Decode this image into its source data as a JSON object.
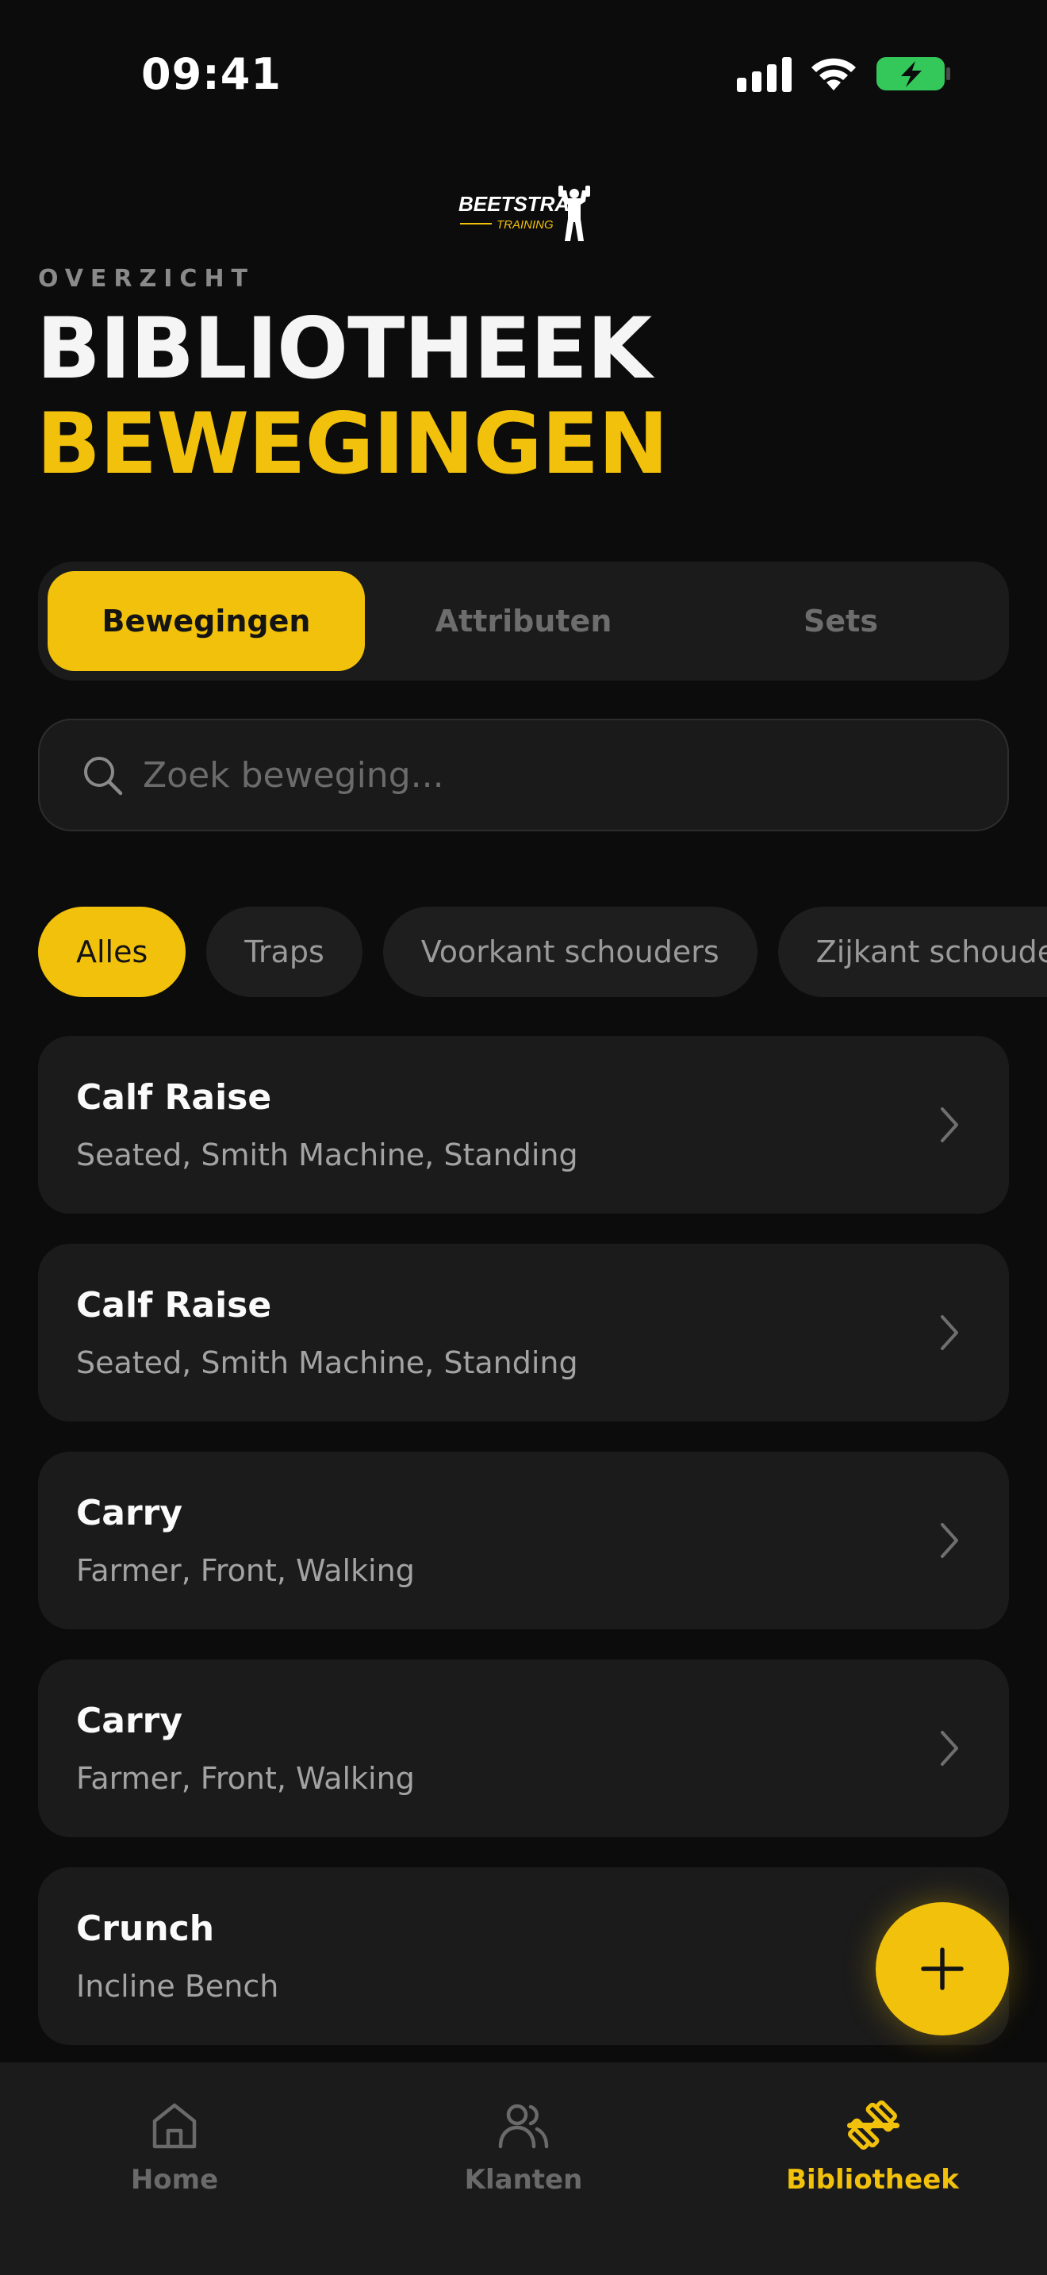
{
  "status_bar": {
    "time": "09:41"
  },
  "brand": {
    "name": "BEETSTRA",
    "tagline": "TRAINING"
  },
  "header": {
    "eyebrow": "OVERZICHT",
    "title_line1": "BIBLIOTHEEK",
    "title_line2": "BEWEGINGEN"
  },
  "tabs": [
    {
      "label": "Bewegingen",
      "active": true
    },
    {
      "label": "Attributen",
      "active": false
    },
    {
      "label": "Sets",
      "active": false
    }
  ],
  "search": {
    "placeholder": "Zoek beweging...",
    "value": ""
  },
  "filters": [
    {
      "label": "Alles",
      "active": true
    },
    {
      "label": "Traps",
      "active": false
    },
    {
      "label": "Voorkant schouders",
      "active": false
    },
    {
      "label": "Zijkant schouders",
      "active": false
    }
  ],
  "movements": [
    {
      "name": "Calf Raise",
      "variants": "Seated, Smith Machine, Standing"
    },
    {
      "name": "Calf Raise",
      "variants": "Seated, Smith Machine, Standing"
    },
    {
      "name": "Carry",
      "variants": "Farmer, Front, Walking"
    },
    {
      "name": "Carry",
      "variants": "Farmer, Front, Walking"
    },
    {
      "name": "Crunch",
      "variants": "Incline Bench"
    }
  ],
  "fab": {
    "icon": "plus-icon"
  },
  "bottom_nav": [
    {
      "label": "Home",
      "icon": "home-icon",
      "active": false
    },
    {
      "label": "Klanten",
      "icon": "users-icon",
      "active": false
    },
    {
      "label": "Bibliotheek",
      "icon": "dumbbell-icon",
      "active": true
    }
  ],
  "colors": {
    "accent": "#f2c10b",
    "background": "#0c0c0c",
    "card": "#1b1b1b",
    "battery": "#34c759"
  }
}
